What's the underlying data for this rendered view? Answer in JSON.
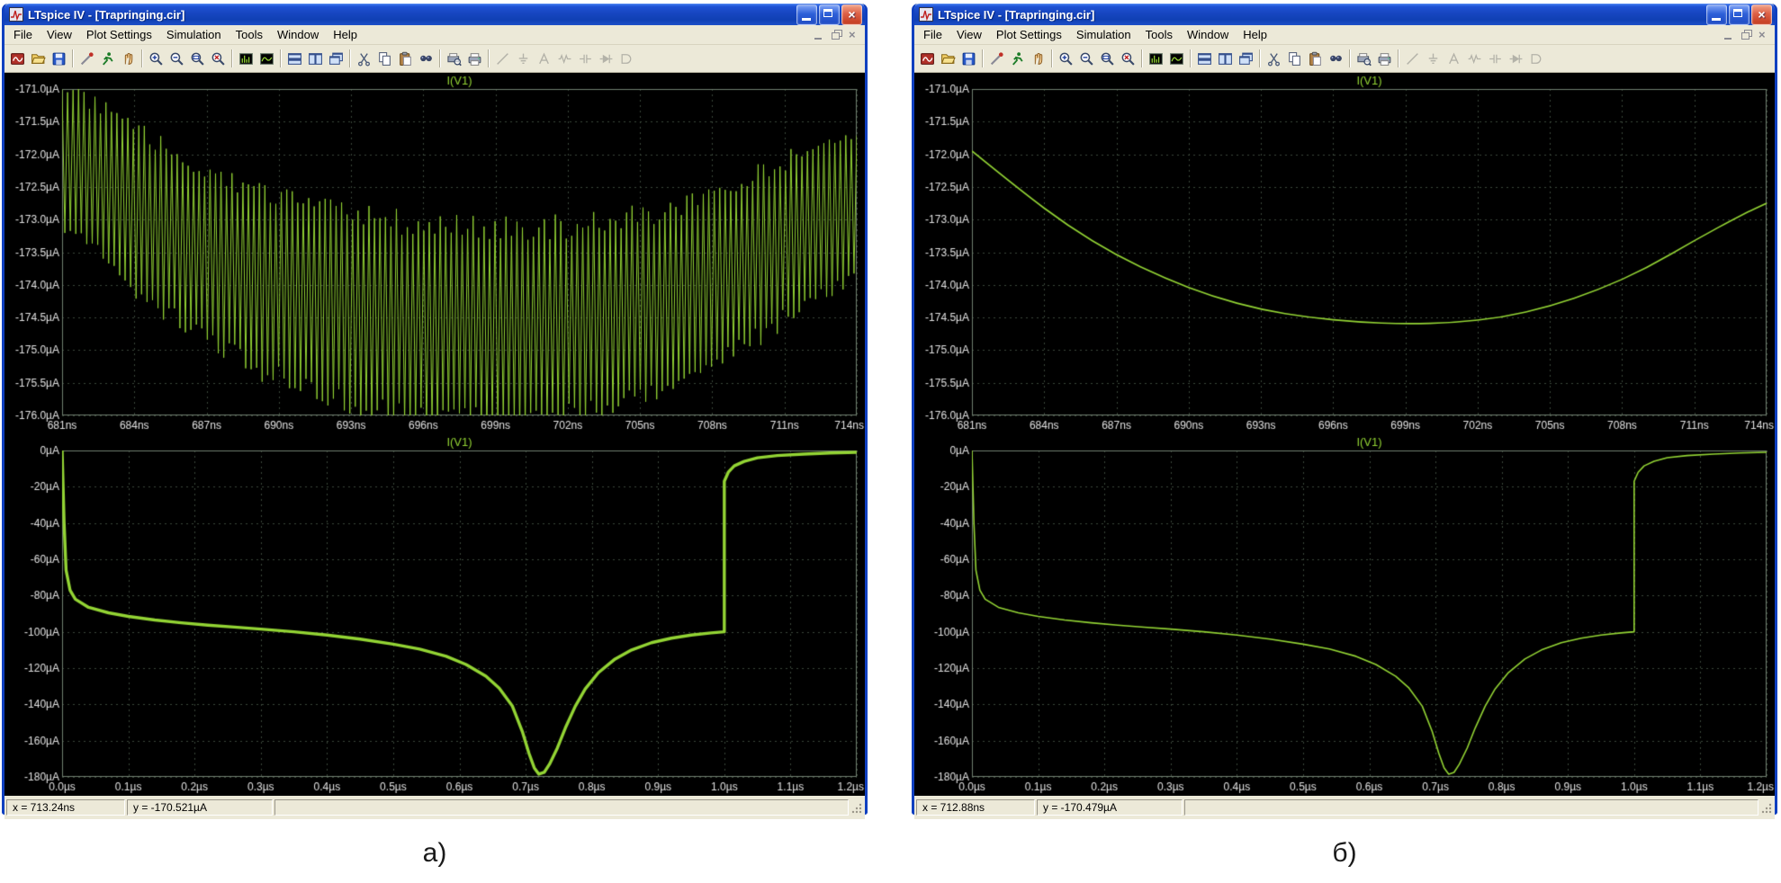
{
  "captions": {
    "left": "а)",
    "right": "б)"
  },
  "window": {
    "title": "LTspice IV - [Trapringing.cir]",
    "menu": [
      "File",
      "View",
      "Plot Settings",
      "Simulation",
      "Tools",
      "Window",
      "Help"
    ],
    "toolbar": [
      {
        "name": "new-schematic",
        "icon": "new"
      },
      {
        "name": "open",
        "icon": "open"
      },
      {
        "name": "save",
        "icon": "save"
      },
      {
        "sep": true
      },
      {
        "name": "probe",
        "icon": "probe"
      },
      {
        "name": "run",
        "icon": "run"
      },
      {
        "name": "halt",
        "icon": "halt"
      },
      {
        "sep": true
      },
      {
        "name": "zoom-in",
        "icon": "zoomin"
      },
      {
        "name": "zoom-out",
        "icon": "zoomout"
      },
      {
        "name": "zoom-full-extents",
        "icon": "zoomfull"
      },
      {
        "name": "zoom-previous",
        "icon": "zoomprev"
      },
      {
        "sep": true
      },
      {
        "name": "fft-view",
        "icon": "fft"
      },
      {
        "name": "plot-settings-view",
        "icon": "plot"
      },
      {
        "sep": true
      },
      {
        "name": "tile-horizontal",
        "icon": "tileh"
      },
      {
        "name": "tile-vertical",
        "icon": "tilev"
      },
      {
        "name": "cascade-windows",
        "icon": "cascade"
      },
      {
        "sep": true
      },
      {
        "name": "cut",
        "icon": "cut"
      },
      {
        "name": "copy",
        "icon": "copy"
      },
      {
        "name": "paste",
        "icon": "paste"
      },
      {
        "name": "find",
        "icon": "find"
      },
      {
        "sep": true
      },
      {
        "name": "print-preview",
        "icon": "preview"
      },
      {
        "name": "print",
        "icon": "print"
      },
      {
        "sep": true
      },
      {
        "name": "draw-wire",
        "icon": "wire",
        "grayed": true
      },
      {
        "name": "ground",
        "icon": "ground",
        "grayed": true
      },
      {
        "name": "net-label",
        "icon": "label",
        "grayed": true
      },
      {
        "name": "resistor",
        "icon": "res",
        "grayed": true
      },
      {
        "name": "capacitor",
        "icon": "cap",
        "grayed": true
      },
      {
        "name": "diode",
        "icon": "diode",
        "grayed": true
      },
      {
        "name": "component",
        "icon": "comp",
        "grayed": true
      }
    ]
  },
  "windows": {
    "left": {
      "status_x": "x = 713.24ns",
      "status_y": "y = -170.521µA"
    },
    "right": {
      "status_x": "x = 712.88ns",
      "status_y": "y = -170.479µA"
    }
  },
  "chart_data": {
    "type": "line",
    "colors": {
      "background": "#000000",
      "grid": "#3a463a",
      "border": "#6f7f6f",
      "text": "#e2e2e2",
      "trace": "#93d434"
    },
    "axes": {
      "top": {
        "x_range": [
          681,
          714
        ],
        "x_tick_values": [
          681,
          684,
          687,
          690,
          693,
          696,
          699,
          702,
          705,
          708,
          711,
          714
        ],
        "x_tick_labels": [
          "681ns",
          "684ns",
          "687ns",
          "690ns",
          "693ns",
          "696ns",
          "699ns",
          "702ns",
          "705ns",
          "708ns",
          "711ns",
          "714ns"
        ],
        "y_range": [
          -176,
          -171
        ],
        "y_tick_values": [
          -171,
          -171.5,
          -172,
          -172.5,
          -173,
          -173.5,
          -174,
          -174.5,
          -175,
          -175.5,
          -176
        ],
        "y_tick_labels": [
          "-171.0µA",
          "-171.5µA",
          "-172.0µA",
          "-172.5µA",
          "-173.0µA",
          "-173.5µA",
          "-174.0µA",
          "-174.5µA",
          "-175.0µA",
          "-175.5µA",
          "-176.0µA"
        ]
      },
      "bottom": {
        "x_range": [
          0,
          1.2
        ],
        "x_tick_values": [
          0,
          0.1,
          0.2,
          0.3,
          0.4,
          0.5,
          0.6,
          0.7,
          0.8,
          0.9,
          1.0,
          1.1,
          1.2
        ],
        "x_tick_labels": [
          "0.0µs",
          "0.1µs",
          "0.2µs",
          "0.3µs",
          "0.4µs",
          "0.5µs",
          "0.6µs",
          "0.7µs",
          "0.8µs",
          "0.9µs",
          "1.0µs",
          "1.1µs",
          "1.2µs"
        ],
        "y_range": [
          -180,
          0
        ],
        "y_tick_values": [
          0,
          -20,
          -40,
          -60,
          -80,
          -100,
          -120,
          -140,
          -160,
          -180
        ],
        "y_tick_labels": [
          "0µA",
          "-20µA",
          "-40µA",
          "-60µA",
          "-80µA",
          "-100µA",
          "-120µA",
          "-140µA",
          "-160µA",
          "-180µA"
        ]
      }
    },
    "points": {
      "top_mean": [
        [
          681,
          -171.95
        ],
        [
          683,
          -172.55
        ],
        [
          685,
          -173.1
        ],
        [
          687,
          -173.55
        ],
        [
          689,
          -173.9
        ],
        [
          691,
          -174.18
        ],
        [
          693,
          -174.38
        ],
        [
          695,
          -174.5
        ],
        [
          697,
          -174.57
        ],
        [
          699,
          -174.6
        ],
        [
          701,
          -174.58
        ],
        [
          703,
          -174.5
        ],
        [
          705,
          -174.33
        ],
        [
          707,
          -174.08
        ],
        [
          709,
          -173.75
        ],
        [
          711,
          -173.32
        ],
        [
          713,
          -172.92
        ],
        [
          714,
          -172.75
        ]
      ],
      "bottom_curve": [
        [
          0,
          0
        ],
        [
          0.003,
          -40
        ],
        [
          0.006,
          -66
        ],
        [
          0.012,
          -77
        ],
        [
          0.02,
          -82
        ],
        [
          0.04,
          -86.5
        ],
        [
          0.07,
          -89.5
        ],
        [
          0.1,
          -91.5
        ],
        [
          0.14,
          -93.5
        ],
        [
          0.18,
          -95
        ],
        [
          0.22,
          -96.3
        ],
        [
          0.26,
          -97.4
        ],
        [
          0.3,
          -98.5
        ],
        [
          0.35,
          -100
        ],
        [
          0.4,
          -101.8
        ],
        [
          0.45,
          -104
        ],
        [
          0.5,
          -106.8
        ],
        [
          0.54,
          -109.5
        ],
        [
          0.58,
          -113.5
        ],
        [
          0.61,
          -118
        ],
        [
          0.64,
          -124.5
        ],
        [
          0.66,
          -131
        ],
        [
          0.68,
          -141
        ],
        [
          0.695,
          -155
        ],
        [
          0.705,
          -167
        ],
        [
          0.713,
          -175
        ],
        [
          0.72,
          -178.5
        ],
        [
          0.728,
          -177.5
        ],
        [
          0.736,
          -173
        ],
        [
          0.748,
          -164
        ],
        [
          0.76,
          -153
        ],
        [
          0.775,
          -141
        ],
        [
          0.79,
          -131.5
        ],
        [
          0.81,
          -122.5
        ],
        [
          0.835,
          -115
        ],
        [
          0.86,
          -110
        ],
        [
          0.89,
          -106
        ],
        [
          0.92,
          -103.5
        ],
        [
          0.95,
          -101.8
        ],
        [
          0.98,
          -100.6
        ],
        [
          1.0,
          -100
        ],
        [
          1.0,
          -17
        ],
        [
          1.006,
          -12
        ],
        [
          1.015,
          -8.5
        ],
        [
          1.03,
          -6
        ],
        [
          1.05,
          -4
        ],
        [
          1.08,
          -2.8
        ],
        [
          1.12,
          -2
        ],
        [
          1.16,
          -1.4
        ],
        [
          1.2,
          -1
        ]
      ]
    },
    "charts": [
      {
        "id": "left-top",
        "title": "I(V1)",
        "axis": "top",
        "series": [
          {
            "name": "I(V1)",
            "type": "ringing",
            "points": "top_mean",
            "amp0": 1.18,
            "amp1": 0.42,
            "cycles": 290,
            "width": 1
          }
        ]
      },
      {
        "id": "left-bottom",
        "title": "I(V1)",
        "axis": "bottom",
        "series": [
          {
            "name": "I(V1)",
            "type": "line",
            "points": "bottom_curve",
            "width": 3.4
          }
        ]
      },
      {
        "id": "right-top",
        "title": "I(V1)",
        "axis": "top",
        "series": [
          {
            "name": "I(V1)",
            "type": "line",
            "smooth": true,
            "points": "top_mean",
            "width": 1.6
          }
        ]
      },
      {
        "id": "right-bottom",
        "title": "I(V1)",
        "axis": "bottom",
        "series": [
          {
            "name": "I(V1)",
            "type": "line",
            "points": "bottom_curve",
            "width": 1.6
          }
        ]
      }
    ]
  }
}
